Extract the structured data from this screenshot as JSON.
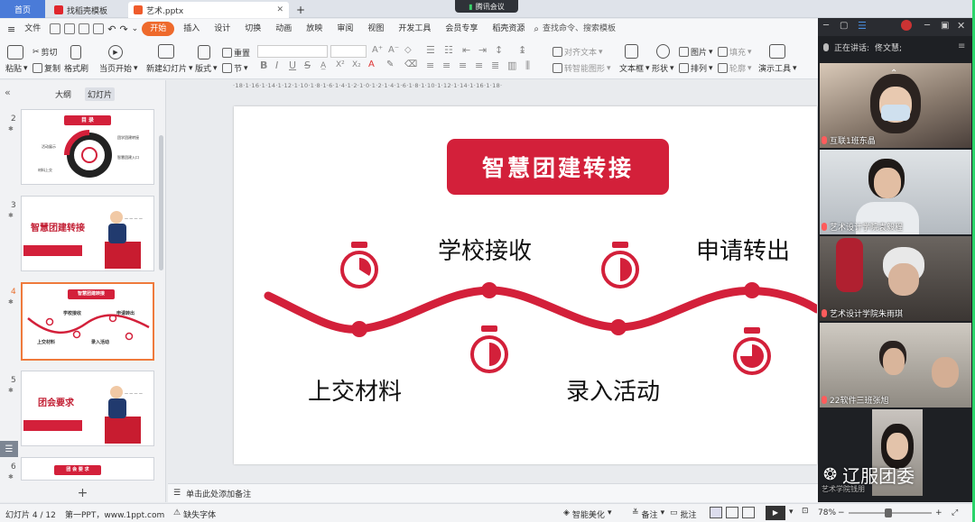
{
  "tabs": {
    "home": "首页",
    "template": "找稻壳模板",
    "file": "艺术.pptx",
    "new_tab": "+"
  },
  "meeting_badge": "腾讯会议",
  "menus": {
    "file": "文件",
    "items": [
      "开始",
      "插入",
      "设计",
      "切换",
      "动画",
      "放映",
      "审阅",
      "视图",
      "开发工具",
      "会员专享",
      "稻壳资源"
    ],
    "search": "查找命令、搜索模板"
  },
  "ribbon": {
    "paste": "粘贴",
    "cut": "剪切",
    "copy": "复制",
    "format_painter": "格式刷",
    "play_from_current": "当页开始",
    "new_slide": "新建幻灯片",
    "layout": "版式",
    "section": "节",
    "reset": "重置",
    "align_text": "对齐文本",
    "smartart": "转智能图形",
    "textbox": "文本框",
    "shape": "形状",
    "arrange": "排列",
    "picture": "图片",
    "fill": "填充",
    "outline": "轮廓",
    "presenter": "演示工具",
    "bold": "B",
    "italic": "I",
    "underline": "U",
    "strike": "S"
  },
  "pane": {
    "outline_tab": "大纲",
    "slides_tab": "幻灯片",
    "add": "+"
  },
  "thumbnails": [
    {
      "num": "2",
      "title": "目 录",
      "items": [
        "活动展示",
        "团学团建转接",
        "智慧团建入口",
        "材料上交"
      ]
    },
    {
      "num": "3",
      "title": "智慧团建转接",
      "page_tag": "— — — —"
    },
    {
      "num": "4",
      "title": "智慧团建转接",
      "labels": [
        "学校接收",
        "申请转出",
        "上交材料",
        "录入活动"
      ]
    },
    {
      "num": "5",
      "title": "团会要求",
      "page_tag": "— — — —"
    },
    {
      "num": "6",
      "title": "团 会 要 求"
    }
  ],
  "ruler_text": "·18·1·16·1·14·1·12·1·10·1·8·1·6·1·4·1·2·1·0·1·2·1·4·1·6·1·8·1·10·1·12·1·14·1·16·1·18·",
  "slide": {
    "title": "智慧团建转接",
    "steps": [
      "上交材料",
      "学校接收",
      "录入活动",
      "申请转出"
    ]
  },
  "notes_placeholder": "单击此处添加备注",
  "status": {
    "slide_count": "幻灯片 4 / 12",
    "template": "第一PPT，www.1ppt.com",
    "missing_font": "缺失字体",
    "beautify": "智能美化",
    "notes": "备注",
    "comments": "批注",
    "zoom": "78%"
  },
  "meeting": {
    "speaking_label": "正在讲话:",
    "speaker": "佟文慧;",
    "participants": [
      "互联1班东晶",
      "艺术设计学院袁毅程",
      "艺术设计学院朱雨琪",
      "22软件三班张旭",
      "艺术学院钱朋"
    ]
  },
  "watermark": "辽服团委",
  "colors": {
    "accent_red": "#d3203a",
    "ribbon_orange": "#ee6a2c"
  }
}
